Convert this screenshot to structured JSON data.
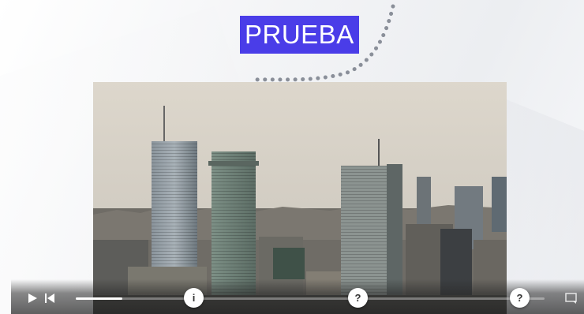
{
  "slide": {
    "title": "PRUEBA",
    "accent_color": "#4a3de8",
    "image": "city-skyline-photo"
  },
  "player": {
    "progress": 0.1,
    "play_icon": "play-icon",
    "restart_icon": "skip-to-start-icon",
    "caption_icon": "captions-icon",
    "markers": [
      {
        "type": "info",
        "symbol": "i"
      },
      {
        "type": "question",
        "symbol": "?"
      },
      {
        "type": "question",
        "symbol": "?"
      }
    ]
  }
}
